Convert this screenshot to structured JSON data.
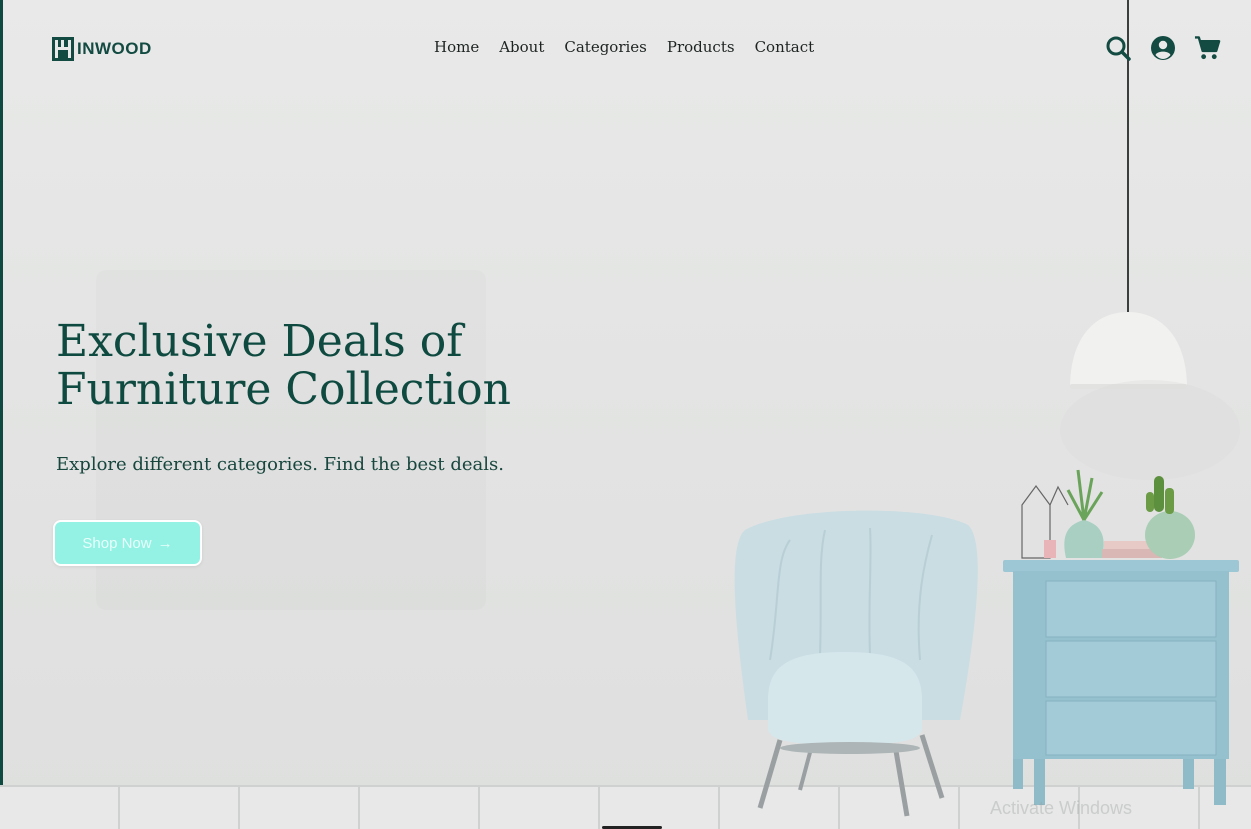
{
  "header": {
    "logo_text": "INWOOD",
    "nav": [
      "Home",
      "About",
      "Categories",
      "Products",
      "Contact"
    ]
  },
  "icons": {
    "search": "search-icon",
    "account": "user-circle-icon",
    "cart": "shopping-cart-icon"
  },
  "hero": {
    "title_line1": "Exclusive Deals of",
    "title_line2": "Furniture Collection",
    "subtitle": "Explore different categories. Find the best deals.",
    "cta_label": "Shop Now",
    "cta_arrow": "→"
  },
  "watermark": "Activate Windows",
  "colors": {
    "brand_green": "#0f4a40",
    "cta_bg": "#93f2e3",
    "furniture_blue": "#9cc6d3"
  }
}
